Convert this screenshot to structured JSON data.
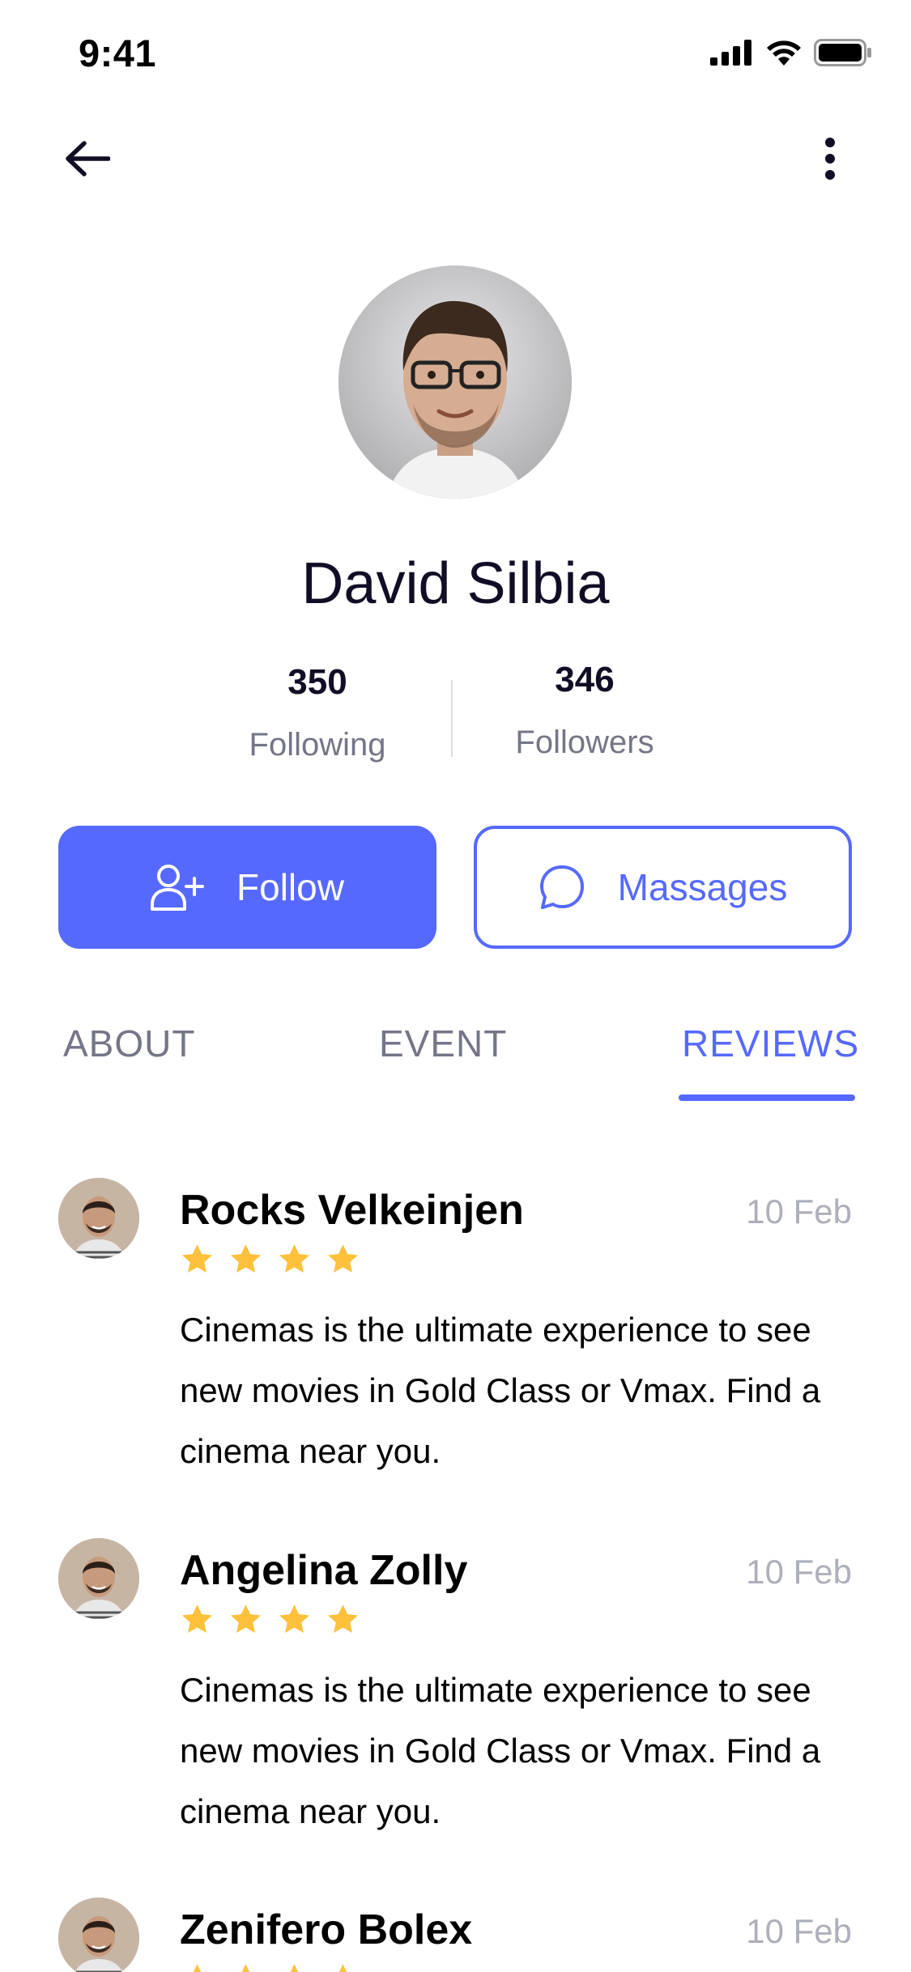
{
  "status_bar": {
    "time": "9:41"
  },
  "header": {
    "back_icon": "arrow-left-icon",
    "more_icon": "more-vertical-icon"
  },
  "profile": {
    "name": "David  Silbia",
    "following_count": "350",
    "following_label": "Following",
    "followers_count": "346",
    "followers_label": "Followers"
  },
  "actions": {
    "follow_label": "Follow",
    "follow_icon": "user-plus-icon",
    "messages_label": "Massages",
    "messages_icon": "chat-bubble-icon"
  },
  "tabs": [
    {
      "label": "ABOUT",
      "active": false
    },
    {
      "label": "EVENT",
      "active": false
    },
    {
      "label": "REVIEWS",
      "active": true
    }
  ],
  "reviews": [
    {
      "name": "Rocks Velkeinjen",
      "date": "10 Feb",
      "rating": 4,
      "text": "Cinemas is the ultimate experience to see new movies in Gold Class or Vmax. Find a cinema near you."
    },
    {
      "name": "Angelina Zolly",
      "date": "10 Feb",
      "rating": 4,
      "text": "Cinemas is the ultimate experience to see new movies in Gold Class or Vmax. Find a cinema near you."
    },
    {
      "name": "Zenifero Bolex",
      "date": "10 Feb",
      "rating": 4,
      "text": ""
    }
  ],
  "colors": {
    "accent": "#5669FF",
    "star": "#FFC13B",
    "title": "#120D26",
    "muted": "#747688",
    "date": "#ADAFBB"
  }
}
